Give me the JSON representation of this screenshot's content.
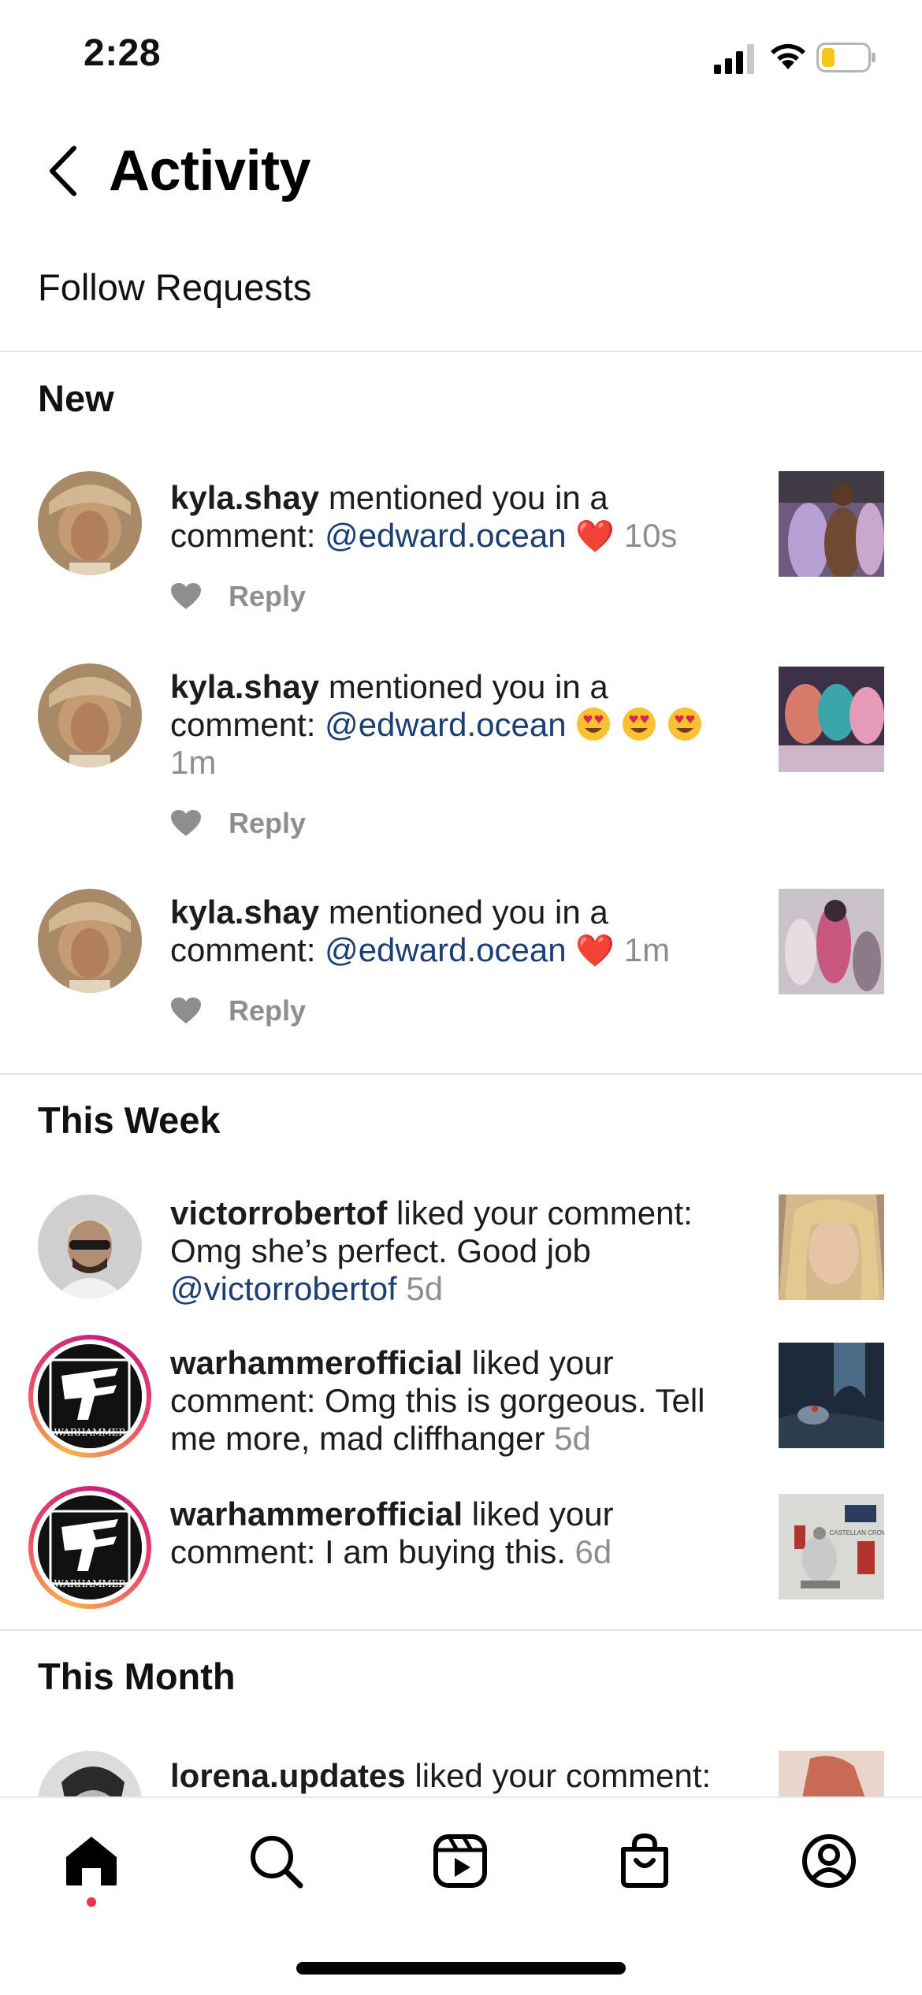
{
  "status_bar": {
    "time": "2:28"
  },
  "header": {
    "title": "Activity"
  },
  "follow_requests": {
    "label": "Follow Requests"
  },
  "sections": {
    "new": "New",
    "this_week": "This Week",
    "this_month": "This Month"
  },
  "new_items": [
    {
      "username": "kyla.shay",
      "action": " mentioned you in a comment: ",
      "mention": "@edward.ocean",
      "emoji": "❤️",
      "time": "10s",
      "reply_label": "Reply"
    },
    {
      "username": "kyla.shay",
      "action": " mentioned you in a comment: ",
      "mention": "@edward.ocean",
      "emoji": "heart-eyes x3",
      "time": "1m",
      "reply_label": "Reply"
    },
    {
      "username": "kyla.shay",
      "action": " mentioned you in a comment: ",
      "mention": "@edward.ocean",
      "emoji": "❤️",
      "time": "1m",
      "reply_label": "Reply"
    }
  ],
  "week_items": [
    {
      "username": "victorrobertof",
      "action": " liked your comment: Omg she’s perfect. Good job ",
      "mention": "@victorrobertof",
      "time": "5d"
    },
    {
      "username": "warhammerofficial",
      "action": " liked your comment: Omg this is gorgeous. Tell me more, mad cliffhanger ",
      "time": "5d"
    },
    {
      "username": "warhammerofficial",
      "action": " liked your comment: I am buying this. ",
      "time": "6d"
    }
  ],
  "month_items": [
    {
      "username": "lorena.updates",
      "action": " liked your comment:"
    }
  ],
  "avatar_text": {
    "warhammer": "WARHAMMER"
  },
  "thumb_text": {
    "castellan": "CASTELLAN CROWE"
  },
  "tabs": [
    "home-icon",
    "search-icon",
    "reels-icon",
    "shop-icon",
    "profile-icon"
  ],
  "colors": {
    "mention": "#1b3f74",
    "time": "#8e8e8e",
    "notification_dot": "#e8334a"
  }
}
